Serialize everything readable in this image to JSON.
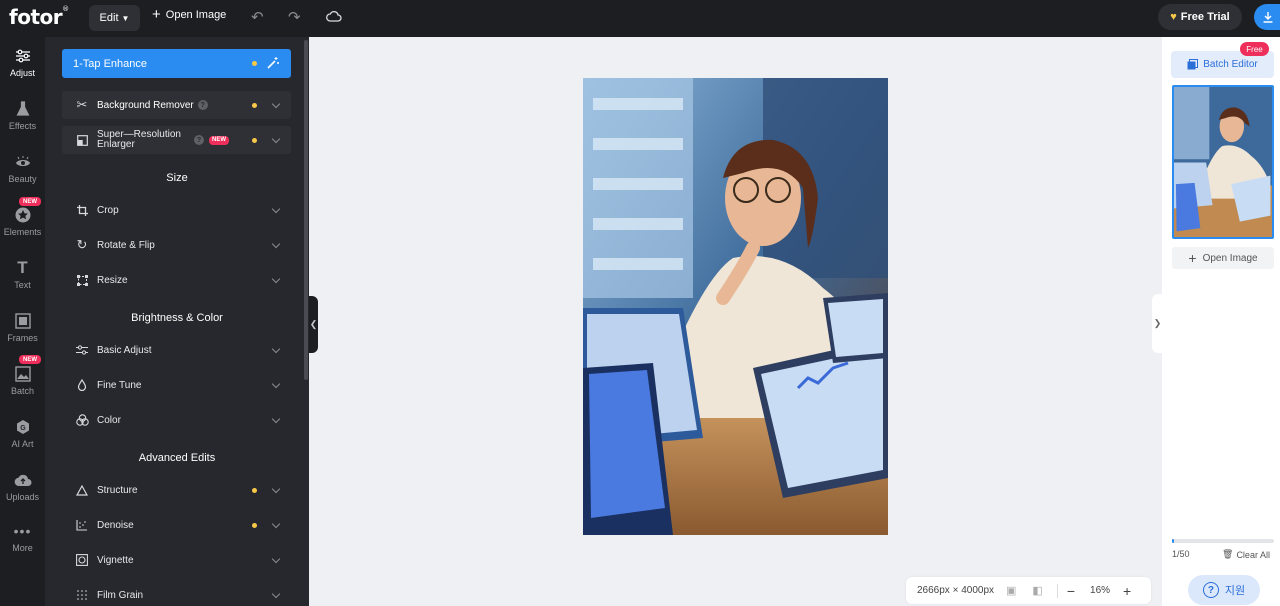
{
  "app": {
    "logo": "fotor",
    "logo_mark": "®"
  },
  "topbar": {
    "edit_label": "Edit",
    "open_image_label": "Open Image",
    "free_trial_label": "Free Trial"
  },
  "nav": {
    "items": [
      {
        "label": "Adjust",
        "icon": "sliders-icon"
      },
      {
        "label": "Effects",
        "icon": "flask-icon"
      },
      {
        "label": "Beauty",
        "icon": "eye-icon"
      },
      {
        "label": "Elements",
        "icon": "star-icon",
        "badge": "NEW"
      },
      {
        "label": "Text",
        "icon": "text-icon"
      },
      {
        "label": "Frames",
        "icon": "frame-icon"
      },
      {
        "label": "Batch",
        "icon": "image-icon",
        "badge": "NEW"
      },
      {
        "label": "AI Art",
        "icon": "ai-icon"
      },
      {
        "label": "Uploads",
        "icon": "cloud-upload-icon"
      },
      {
        "label": "More",
        "icon": "dots-icon"
      }
    ]
  },
  "panel": {
    "enhance_label": "1-Tap Enhance",
    "bg_remover_label": "Background Remover",
    "super_res_line1": "Super—Resolution",
    "super_res_line2": "Enlarger",
    "new_badge": "NEW",
    "help_mark": "?",
    "sections": {
      "size": "Size",
      "brightness": "Brightness & Color",
      "advanced": "Advanced Edits"
    },
    "size_items": [
      "Crop",
      "Rotate & Flip",
      "Resize"
    ],
    "brightness_items": [
      "Basic Adjust",
      "Fine Tune",
      "Color"
    ],
    "advanced_items": [
      "Structure",
      "Denoise",
      "Vignette",
      "Film Grain"
    ]
  },
  "canvas": {
    "dimensions": "2666px × 4000px",
    "zoom": "16%"
  },
  "right": {
    "batch_editor_label": "Batch Editor",
    "free_tag": "Free",
    "open_image_label": "Open Image",
    "count": "1/50",
    "clear_all_label": "Clear All",
    "help_label": "지원",
    "progress": 0.02
  },
  "colors": {
    "accent": "#2a8cf0",
    "badge": "#ef2f5b",
    "dot": "#f7c948"
  }
}
